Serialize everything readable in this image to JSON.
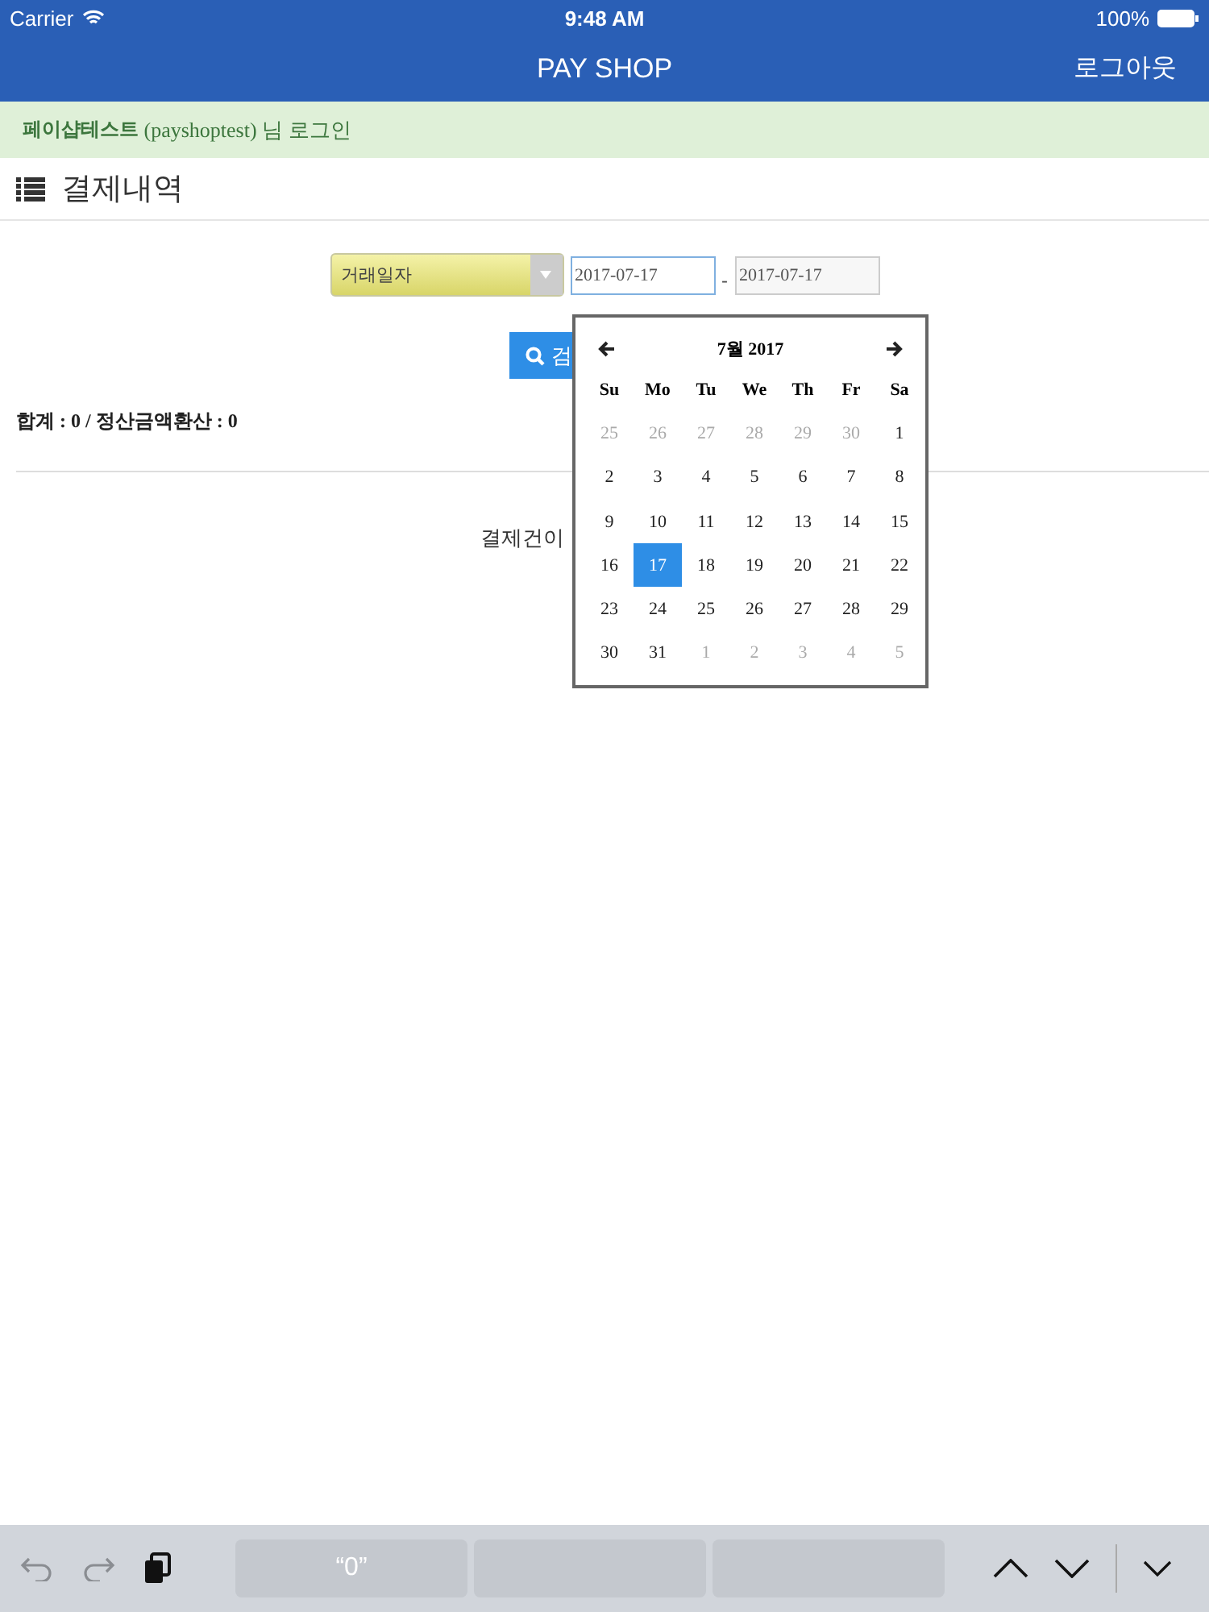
{
  "status_bar": {
    "carrier": "Carrier",
    "time": "9:48 AM",
    "battery": "100%"
  },
  "nav": {
    "title": "PAY SHOP",
    "logout": "로그아웃"
  },
  "login_notice": {
    "name": "페이샵테스트",
    "text": "(payshoptest) 님 로그인"
  },
  "section_title": "결제내역",
  "filter": {
    "select": "거래일자",
    "date_from": "2017-07-17",
    "separator": "-",
    "date_to": "2017-07-17",
    "from_focused": true
  },
  "search_button": "검",
  "summary": "합계 : 0 / 정산금액환산 : 0",
  "empty_message": "결제건이",
  "calendar": {
    "title": "7월 2017",
    "weekdays": [
      "Su",
      "Mo",
      "Tu",
      "We",
      "Th",
      "Fr",
      "Sa"
    ],
    "weeks": [
      [
        {
          "day": "25",
          "muted": true,
          "selected": false
        },
        {
          "day": "26",
          "muted": true,
          "selected": false
        },
        {
          "day": "27",
          "muted": true,
          "selected": false
        },
        {
          "day": "28",
          "muted": true,
          "selected": false
        },
        {
          "day": "29",
          "muted": true,
          "selected": false
        },
        {
          "day": "30",
          "muted": true,
          "selected": false
        },
        {
          "day": "1",
          "muted": false,
          "selected": false
        }
      ],
      [
        {
          "day": "2",
          "muted": false,
          "selected": false
        },
        {
          "day": "3",
          "muted": false,
          "selected": false
        },
        {
          "day": "4",
          "muted": false,
          "selected": false
        },
        {
          "day": "5",
          "muted": false,
          "selected": false
        },
        {
          "day": "6",
          "muted": false,
          "selected": false
        },
        {
          "day": "7",
          "muted": false,
          "selected": false
        },
        {
          "day": "8",
          "muted": false,
          "selected": false
        }
      ],
      [
        {
          "day": "9",
          "muted": false,
          "selected": false
        },
        {
          "day": "10",
          "muted": false,
          "selected": false
        },
        {
          "day": "11",
          "muted": false,
          "selected": false
        },
        {
          "day": "12",
          "muted": false,
          "selected": false
        },
        {
          "day": "13",
          "muted": false,
          "selected": false
        },
        {
          "day": "14",
          "muted": false,
          "selected": false
        },
        {
          "day": "15",
          "muted": false,
          "selected": false
        }
      ],
      [
        {
          "day": "16",
          "muted": false,
          "selected": false
        },
        {
          "day": "17",
          "muted": false,
          "selected": true
        },
        {
          "day": "18",
          "muted": false,
          "selected": false
        },
        {
          "day": "19",
          "muted": false,
          "selected": false
        },
        {
          "day": "20",
          "muted": false,
          "selected": false
        },
        {
          "day": "21",
          "muted": false,
          "selected": false
        },
        {
          "day": "22",
          "muted": false,
          "selected": false
        }
      ],
      [
        {
          "day": "23",
          "muted": false,
          "selected": false
        },
        {
          "day": "24",
          "muted": false,
          "selected": false
        },
        {
          "day": "25",
          "muted": false,
          "selected": false
        },
        {
          "day": "26",
          "muted": false,
          "selected": false
        },
        {
          "day": "27",
          "muted": false,
          "selected": false
        },
        {
          "day": "28",
          "muted": false,
          "selected": false
        },
        {
          "day": "29",
          "muted": false,
          "selected": false
        }
      ],
      [
        {
          "day": "30",
          "muted": false,
          "selected": false
        },
        {
          "day": "31",
          "muted": false,
          "selected": false
        },
        {
          "day": "1",
          "muted": true,
          "selected": false
        },
        {
          "day": "2",
          "muted": true,
          "selected": false
        },
        {
          "day": "3",
          "muted": true,
          "selected": false
        },
        {
          "day": "4",
          "muted": true,
          "selected": false
        },
        {
          "day": "5",
          "muted": true,
          "selected": false
        }
      ]
    ]
  },
  "keyboard_bar": {
    "suggestions": [
      "“0”"
    ]
  }
}
